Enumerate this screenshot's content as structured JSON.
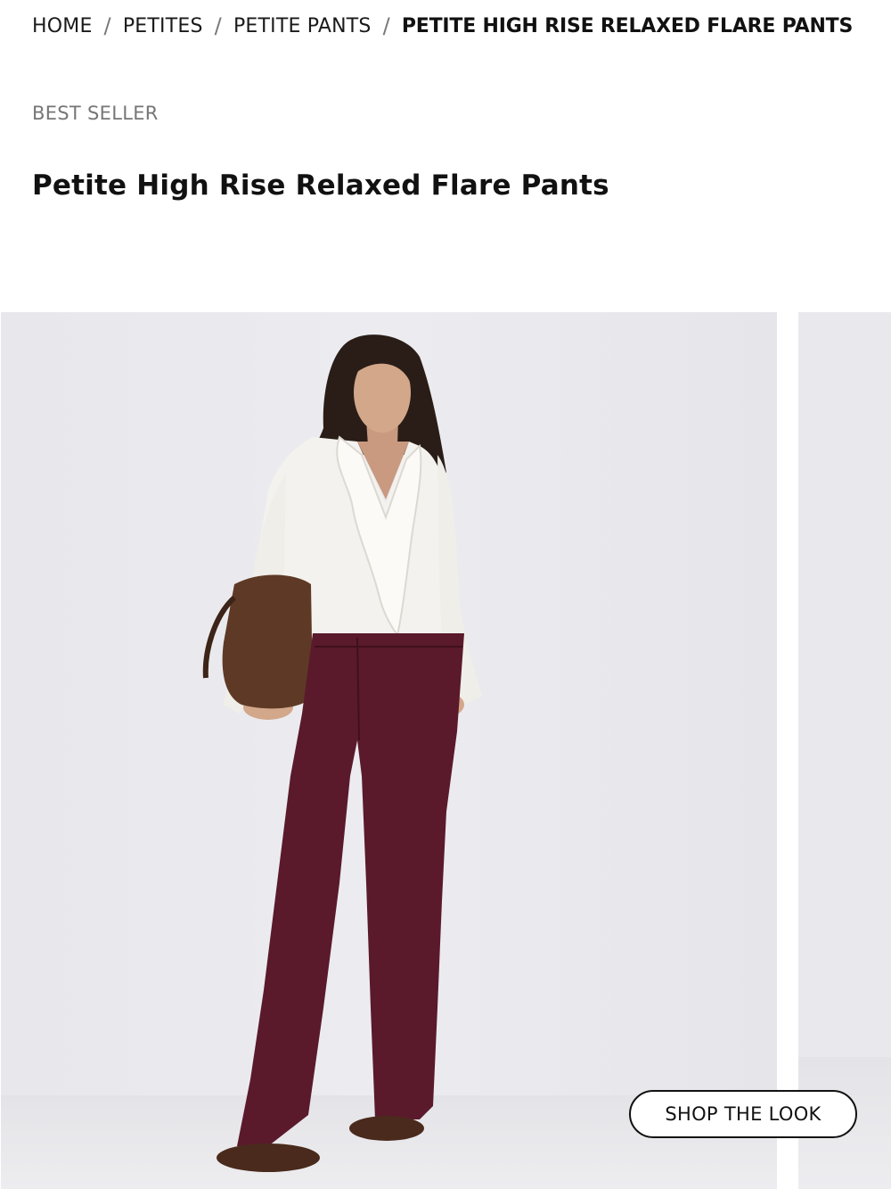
{
  "breadcrumb": {
    "items": [
      "HOME",
      "PETITES",
      "PETITE PANTS"
    ],
    "current": "PETITE HIGH RISE RELAXED FLARE PANTS",
    "separator": "/"
  },
  "product": {
    "badge": "BEST SELLER",
    "title": "Petite High Rise Relaxed Flare Pants"
  },
  "gallery": {
    "shop_the_look_label": "SHOP THE LOOK",
    "image_alt": "Model wearing Petite High Rise Relaxed Flare Pants in burgundy with white ruffle blouse and brown suede bag"
  },
  "colors": {
    "background": "#ffffff",
    "photo_background": "#e9e9ed",
    "pants": "#5a1a2c",
    "blouse": "#f4f2ee",
    "bag": "#5e3a26",
    "text": "#111111",
    "muted_text": "#767676"
  }
}
